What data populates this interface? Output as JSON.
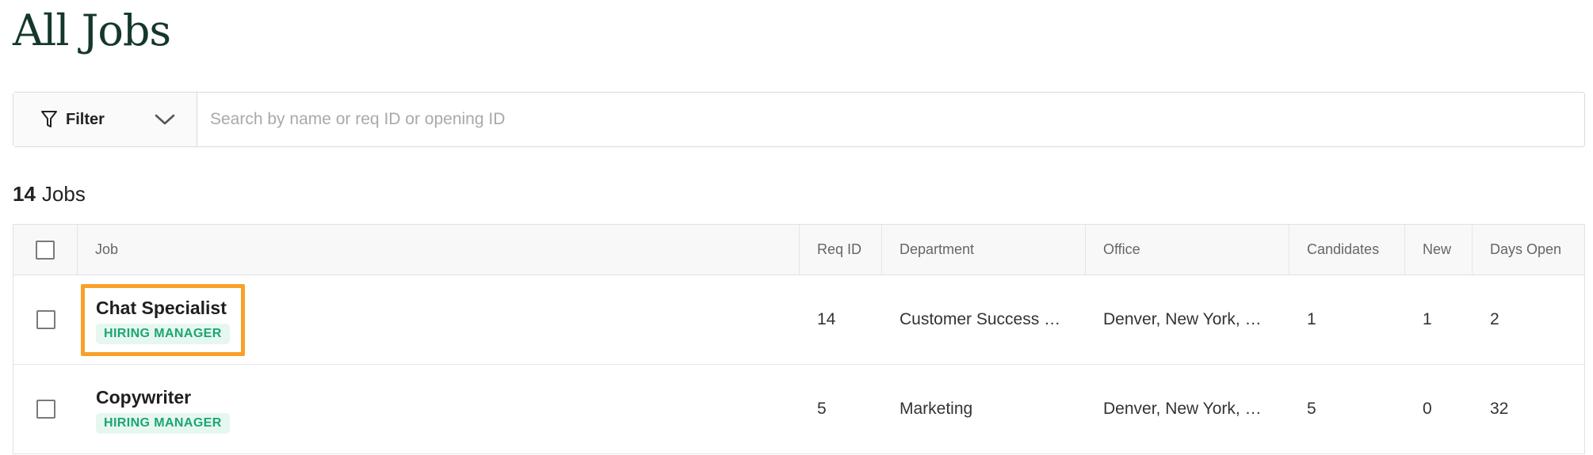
{
  "page": {
    "title": "All Jobs"
  },
  "colors": {
    "accent": "#15372c",
    "highlight": "#f7a128",
    "badge_text": "#1ba672",
    "badge_bg": "#e6f7f0"
  },
  "filter": {
    "label": "Filter",
    "icon": "funnel-icon",
    "dropdown_icon": "chevron-down-icon"
  },
  "search": {
    "placeholder": "Search by name or req ID or opening ID",
    "value": ""
  },
  "summary": {
    "count": "14",
    "label": "Jobs"
  },
  "table": {
    "columns": [
      "Job",
      "Req ID",
      "Department",
      "Office",
      "Candidates",
      "New",
      "Days Open"
    ],
    "rows": [
      {
        "job": "Chat Specialist",
        "badge": "HIRING MANAGER",
        "req_id": "14",
        "department": "Customer Success a...",
        "office": "Denver, New York, S...",
        "candidates": "1",
        "new": "1",
        "days_open": "2",
        "highlighted": true
      },
      {
        "job": "Copywriter",
        "badge": "HIRING MANAGER",
        "req_id": "5",
        "department": "Marketing",
        "office": "Denver, New York, S...",
        "candidates": "5",
        "new": "0",
        "days_open": "32",
        "highlighted": false
      }
    ]
  }
}
